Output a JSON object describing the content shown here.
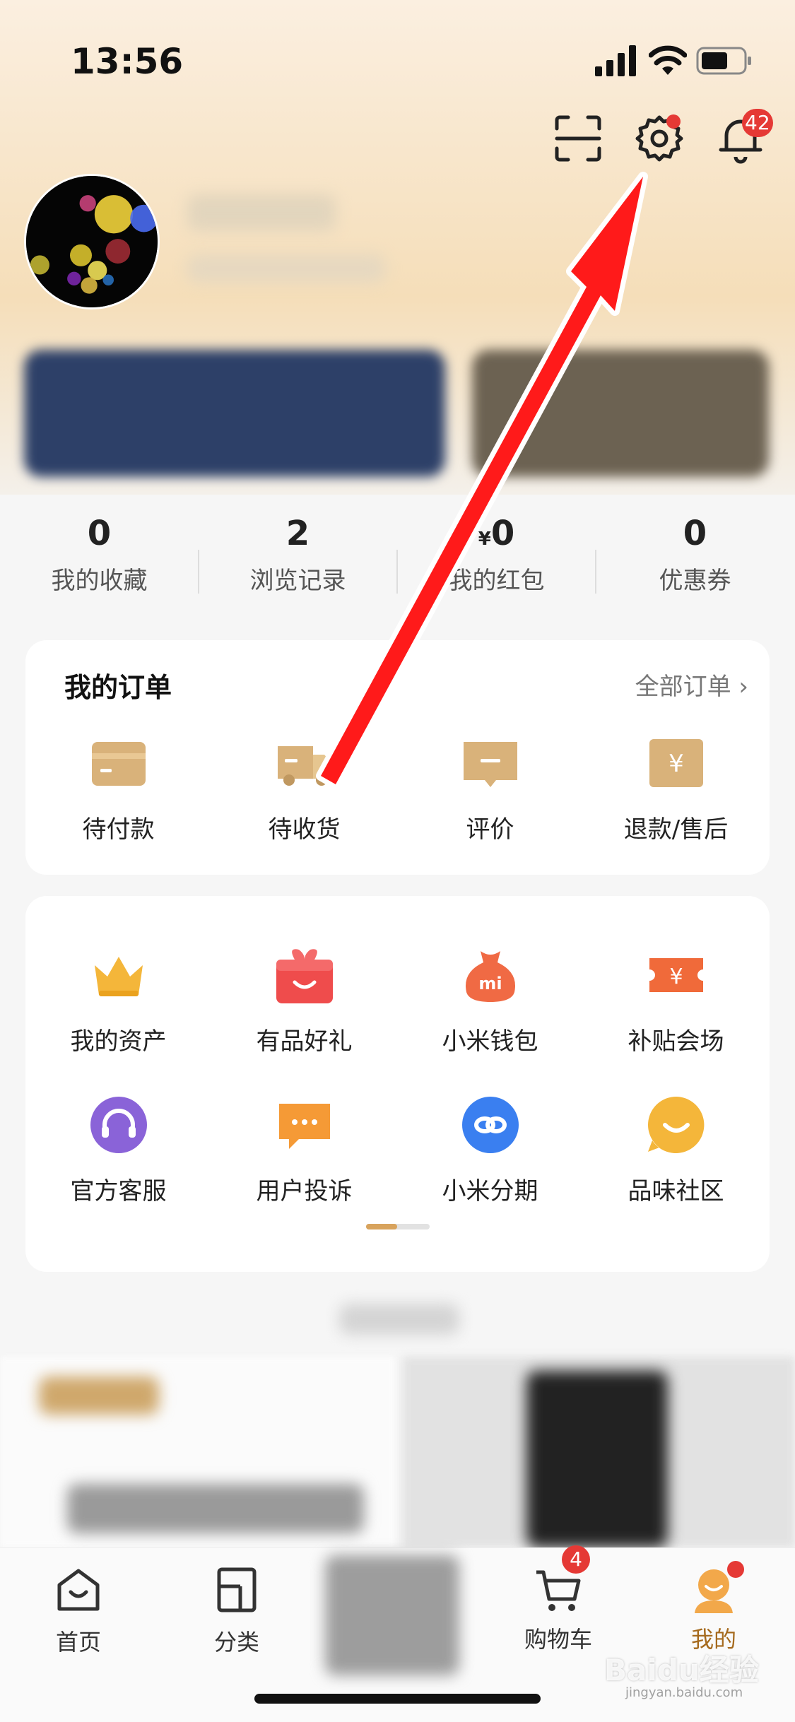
{
  "status_bar": {
    "time": "13:56"
  },
  "header": {
    "notification_count": "42"
  },
  "stats": [
    {
      "value": "0",
      "label": "我的收藏"
    },
    {
      "value": "2",
      "label": "浏览记录"
    },
    {
      "value": "0",
      "currency": "¥",
      "label": "我的红包"
    },
    {
      "value": "0",
      "label": "优惠券"
    }
  ],
  "orders": {
    "title": "我的订单",
    "all_link": "全部订单",
    "items": [
      {
        "label": "待付款",
        "icon": "card-icon"
      },
      {
        "label": "待收货",
        "icon": "truck-icon"
      },
      {
        "label": "评价",
        "icon": "comment-icon"
      },
      {
        "label": "退款/售后",
        "icon": "refund-icon"
      }
    ]
  },
  "services": {
    "row1": [
      {
        "label": "我的资产",
        "icon": "crown-icon"
      },
      {
        "label": "有品好礼",
        "icon": "gift-icon"
      },
      {
        "label": "小米钱包",
        "icon": "wallet-bag-icon",
        "icon_text": "mi"
      },
      {
        "label": "补贴会场",
        "icon": "ticket-icon"
      }
    ],
    "row2": [
      {
        "label": "官方客服",
        "icon": "headset-icon"
      },
      {
        "label": "用户投诉",
        "icon": "message-icon"
      },
      {
        "label": "小米分期",
        "icon": "link-icon"
      },
      {
        "label": "品味社区",
        "icon": "smile-icon"
      }
    ]
  },
  "tabbar": {
    "items": [
      {
        "label": "首页",
        "icon": "home-icon"
      },
      {
        "label": "分类",
        "icon": "category-icon"
      },
      {
        "label": "购物车",
        "icon": "cart-icon",
        "badge": "4"
      },
      {
        "label": "我的",
        "icon": "profile-icon"
      }
    ]
  },
  "watermark": {
    "brand": "Baidu经验",
    "url": "jingyan.baidu.com"
  },
  "colors": {
    "accent": "#d8a35d",
    "badge": "#e53935",
    "arrow": "#ff1a1a"
  }
}
